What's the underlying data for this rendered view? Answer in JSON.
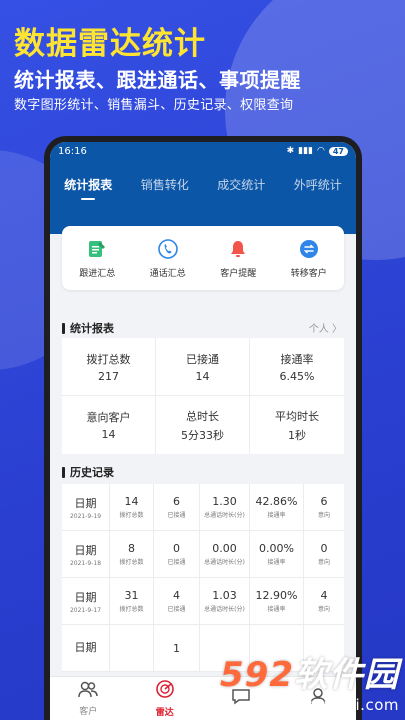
{
  "promo": {
    "title": "数据雷达统计",
    "subtitle": "统计报表、跟进通话、事项提醒",
    "subtitle2": "数字图形统计、销售漏斗、历史记录、权限查询"
  },
  "status": {
    "time": "16:16",
    "battery": "47"
  },
  "tabs": [
    "统计报表",
    "销售转化",
    "成交统计",
    "外呼统计"
  ],
  "quick": [
    {
      "label": "跟进汇总",
      "icon": "edit-doc-icon",
      "color": "#35c07e"
    },
    {
      "label": "通话汇总",
      "icon": "phone-icon",
      "color": "#2f86e8"
    },
    {
      "label": "客户提醒",
      "icon": "bell-icon",
      "color": "#f2544a"
    },
    {
      "label": "转移客户",
      "icon": "transfer-icon",
      "color": "#2f86e8"
    }
  ],
  "stats_section": {
    "title": "统计报表",
    "link": "个人 〉"
  },
  "stats": [
    {
      "label": "拨打总数",
      "value": "217"
    },
    {
      "label": "已接通",
      "value": "14"
    },
    {
      "label": "接通率",
      "value": "6.45%"
    },
    {
      "label": "意向客户",
      "value": "14"
    },
    {
      "label": "总时长",
      "value": "5分33秒"
    },
    {
      "label": "平均时长",
      "value": "1秒"
    }
  ],
  "history_section": {
    "title": "历史记录"
  },
  "history": [
    {
      "date_label": "日期",
      "date": "2021-9-19",
      "calls": "14",
      "calls_lbl": "拨打总数",
      "connected": "6",
      "connected_lbl": "已接通",
      "duration": "1.30",
      "duration_lbl": "总通话时长(分)",
      "rate": "42.86%",
      "rate_lbl": "接通率",
      "intent": "6",
      "intent_lbl": "意向"
    },
    {
      "date_label": "日期",
      "date": "2021-9-18",
      "calls": "8",
      "calls_lbl": "拨打总数",
      "connected": "0",
      "connected_lbl": "已接通",
      "duration": "0.00",
      "duration_lbl": "总通话时长(分)",
      "rate": "0.00%",
      "rate_lbl": "接通率",
      "intent": "0",
      "intent_lbl": "意向"
    },
    {
      "date_label": "日期",
      "date": "2021-9-17",
      "calls": "31",
      "calls_lbl": "拨打总数",
      "connected": "4",
      "connected_lbl": "已接通",
      "duration": "1.03",
      "duration_lbl": "总通话时长(分)",
      "rate": "12.90%",
      "rate_lbl": "接通率",
      "intent": "4",
      "intent_lbl": "意向"
    },
    {
      "date_label": "日期",
      "date": "",
      "calls": "",
      "calls_lbl": "",
      "connected": "1",
      "connected_lbl": "",
      "duration": "",
      "duration_lbl": "",
      "rate": "",
      "rate_lbl": "",
      "intent": "",
      "intent_lbl": ""
    }
  ],
  "nav": [
    {
      "label": "客户",
      "icon": "people-icon"
    },
    {
      "label": "雷达",
      "icon": "radar-icon"
    },
    {
      "label": "",
      "icon": "message-icon"
    },
    {
      "label": "",
      "icon": "user-icon"
    }
  ],
  "watermark": {
    "num": "592",
    "text": "软件园",
    "url": "www.592xiazai.com"
  }
}
